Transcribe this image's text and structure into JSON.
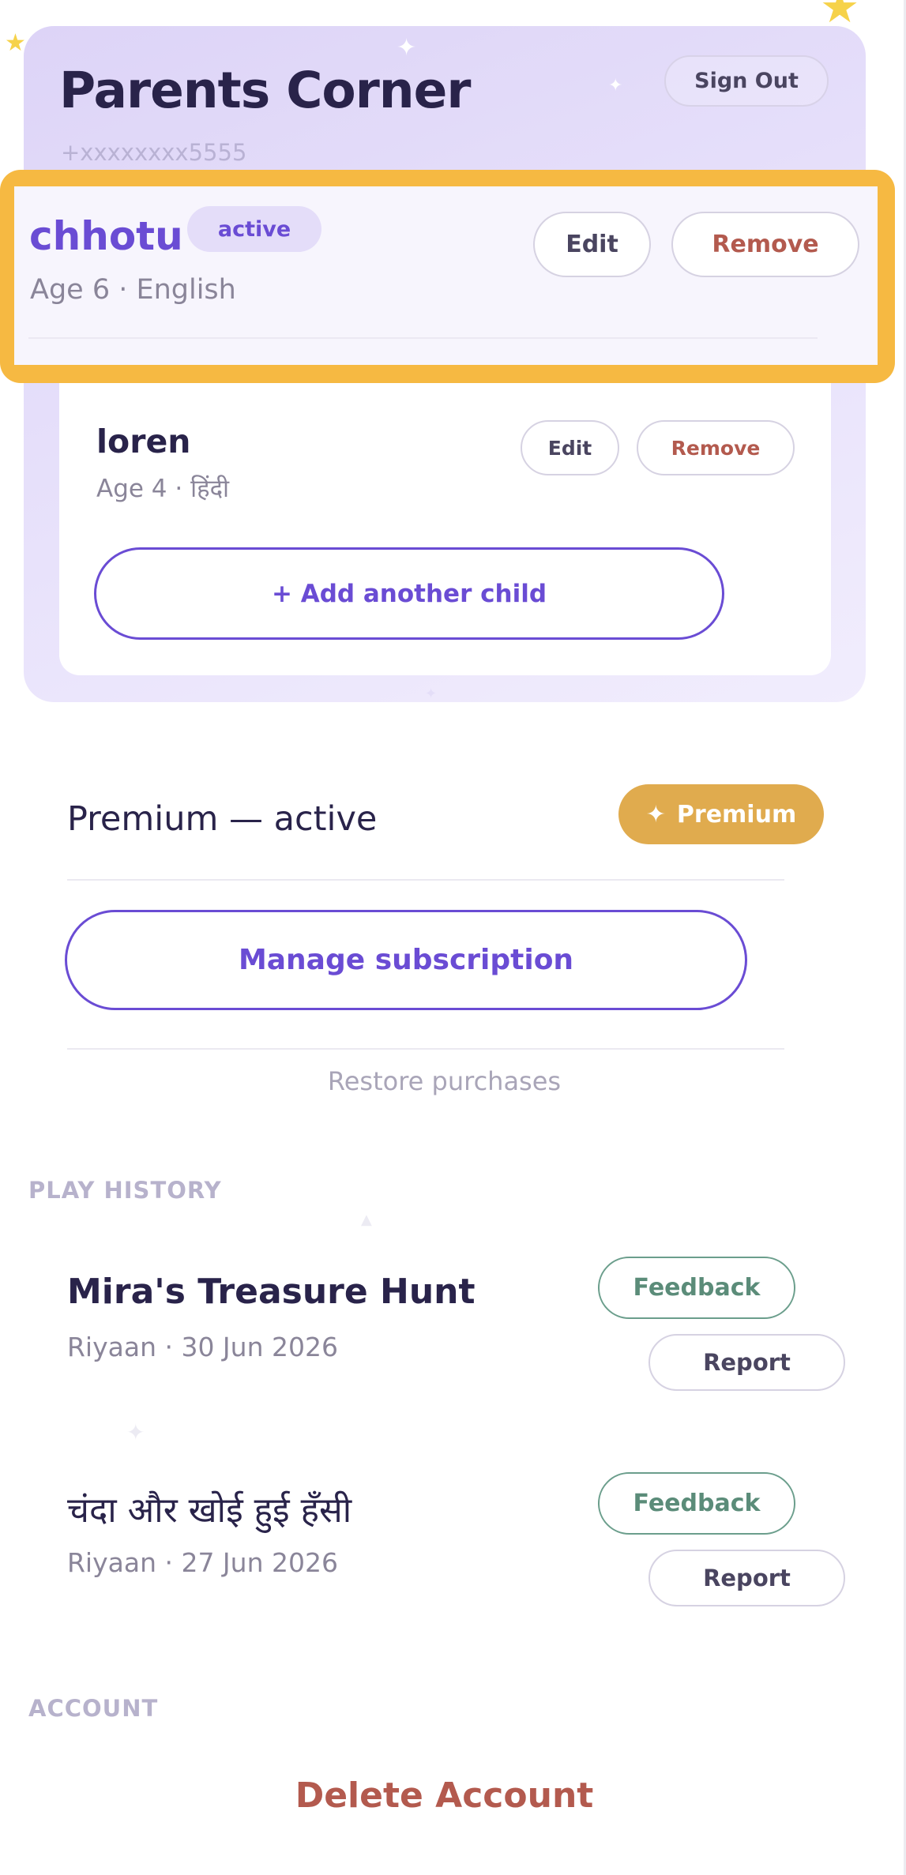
{
  "header": {
    "title": "Parents Corner",
    "phone": "+xxxxxxxx5555",
    "sign_out_label": "Sign Out"
  },
  "children": [
    {
      "name": "chhotu",
      "badge": "active",
      "meta": "Age 6 · English",
      "edit_label": "Edit",
      "remove_label": "Remove"
    },
    {
      "name": "loren",
      "meta": "Age 4 · हिंदी",
      "edit_label": "Edit",
      "remove_label": "Remove"
    }
  ],
  "add_child_label": "+ Add another child",
  "subscription": {
    "status": "Premium — active",
    "pill_label": "Premium",
    "manage_label": "Manage subscription",
    "restore_label": "Restore purchases"
  },
  "play_history": {
    "heading": "PLAY HISTORY",
    "items": [
      {
        "title": "Mira's Treasure Hunt",
        "meta": "Riyaan · 30 Jun 2026",
        "feedback_label": "Feedback",
        "report_label": "Report"
      },
      {
        "title": "चंदा और खोई हुई हँसी",
        "meta": "Riyaan · 27 Jun 2026",
        "feedback_label": "Feedback",
        "report_label": "Report"
      }
    ]
  },
  "account": {
    "heading": "ACCOUNT",
    "delete_label": "Delete Account"
  },
  "colors": {
    "accent_purple": "#6a4cd4",
    "highlight": "#f6b942",
    "premium_gold": "#e0ab4e",
    "danger": "#b35a4e",
    "feedback_green": "#5b8c79"
  },
  "icons": [
    "sparkle-icon",
    "star-icon"
  ]
}
